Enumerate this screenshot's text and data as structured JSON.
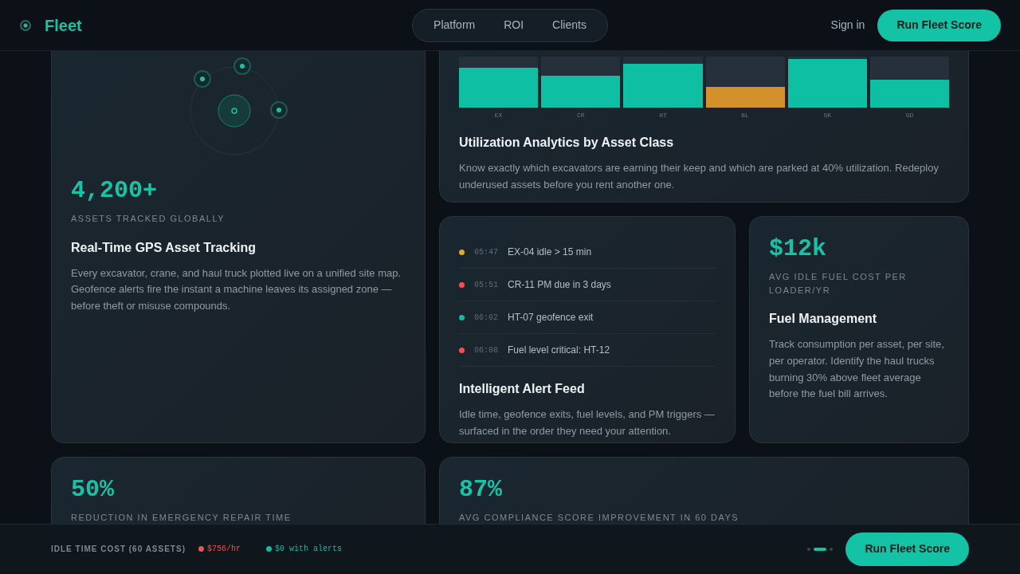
{
  "brand": {
    "name": "Fleet"
  },
  "nav": {
    "links": [
      {
        "label": "Platform"
      },
      {
        "label": "ROI"
      },
      {
        "label": "Clients"
      }
    ],
    "signin": "Sign in",
    "cta": "Run Fleet Score"
  },
  "tracking_card": {
    "stat": "4,200+",
    "stat_label": "ASSETS TRACKED GLOBALLY",
    "title": "Real-Time GPS Asset Tracking",
    "text": "Every excavator, crane, and haul truck plotted live on a unified site map. Geofence alerts fire the instant a machine leaves its assigned zone — before theft or misuse compounds."
  },
  "utilization_card": {
    "bars": [
      {
        "label": "EX",
        "color": "#0fbfa3"
      },
      {
        "label": "CR",
        "color": "#0fbfa3"
      },
      {
        "label": "HT",
        "color": "#0fbfa3"
      },
      {
        "label": "BL",
        "color": "#d4902a"
      },
      {
        "label": "SK",
        "color": "#0fbfa3"
      },
      {
        "label": "GD",
        "color": "#0fbfa3"
      }
    ],
    "title": "Utilization Analytics by Asset Class",
    "text": "Know exactly which excavators are earning their keep and which are parked at 40% utilization. Redeploy underused assets before you rent another one."
  },
  "alert_card": {
    "alerts": [
      {
        "time": "05:47",
        "text": "EX-04 idle > 15 min",
        "color": "#e0a82e"
      },
      {
        "time": "05:51",
        "text": "CR-11 PM due in 3 days",
        "color": "#ef5350"
      },
      {
        "time": "06:02",
        "text": "HT-07 geofence exit",
        "color": "#14b8a6"
      },
      {
        "time": "06:08",
        "text": "Fuel level critical: HT-12",
        "color": "#ef5350"
      }
    ],
    "title": "Intelligent Alert Feed",
    "text": "Idle time, geofence exits, fuel levels, and PM triggers — surfaced in the order they need your attention."
  },
  "fuel_card": {
    "stat": "$12k",
    "stat_label": "AVG IDLE FUEL COST PER LOADER/YR",
    "title": "Fuel Management",
    "text": "Track consumption per asset, per site, per operator. Identify the haul trucks burning 30% above fleet average before the fuel bill arrives."
  },
  "bottom_cards": [
    {
      "stat": "50%",
      "stat_label": "REDUCTION IN EMERGENCY REPAIR TIME"
    },
    {
      "stat": "87%",
      "stat_label": "AVG COMPLIANCE SCORE IMPROVEMENT IN 60 DAYS"
    }
  ],
  "footer_bar": {
    "label": "IDLE TIME COST (60 ASSETS)",
    "items": [
      {
        "text": "$756/hr",
        "color": "#ef5350"
      },
      {
        "text": "$0 with alerts",
        "color": "#14b8a6"
      }
    ],
    "pager": [
      {
        "selected": false
      },
      {
        "selected": true
      },
      {
        "selected": false
      }
    ],
    "cta": "Run Fleet Score"
  }
}
